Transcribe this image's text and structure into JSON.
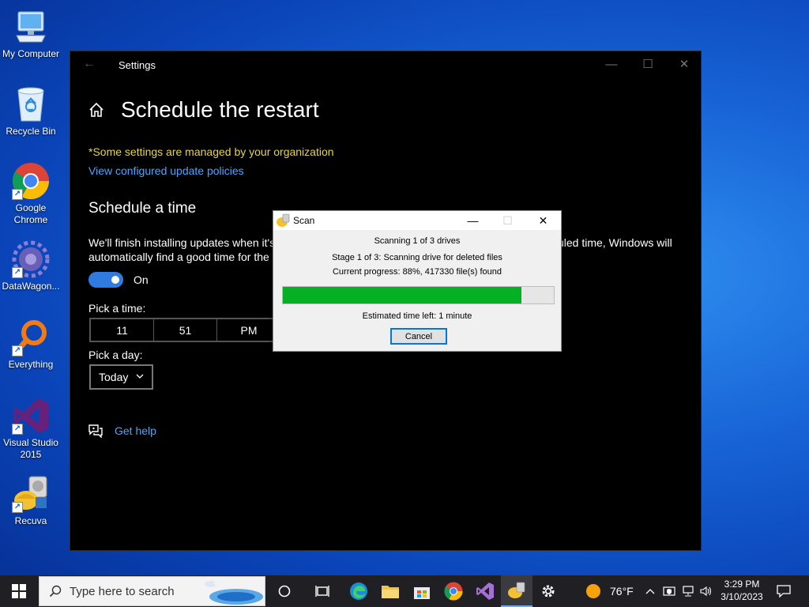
{
  "desktop": {
    "icons": [
      {
        "label": "My Computer",
        "icon": "computer-icon"
      },
      {
        "label": "Recycle Bin",
        "icon": "recycle-bin-icon"
      },
      {
        "label": "Google Chrome",
        "icon": "chrome-icon"
      },
      {
        "label": "DataWagon...",
        "icon": "datawagon-icon"
      },
      {
        "label": "Everything",
        "icon": "everything-search-icon"
      },
      {
        "label": "Visual Studio 2015",
        "icon": "visual-studio-icon"
      },
      {
        "label": "Recuva",
        "icon": "recuva-icon"
      }
    ]
  },
  "settings": {
    "window_title": "Settings",
    "page_title": "Schedule the restart",
    "org_note": "*Some settings are managed by your organization",
    "policy_link": "View configured update policies",
    "section_title": "Schedule a time",
    "description_left_1": "We'll finish installing updates when it's",
    "description_left_2": "automatically find a good time for the",
    "description_right": "uled time, Windows will",
    "toggle_label": "On",
    "toggle_state": "on",
    "pick_time_label": "Pick a time:",
    "time": {
      "hour": "11",
      "minute": "51",
      "period": "PM"
    },
    "pick_day_label": "Pick a day:",
    "day_value": "Today",
    "get_help": "Get help",
    "colors": {
      "accent": "#2f7be0",
      "link": "#4aa6ff",
      "warning": "#e5d44c"
    }
  },
  "scan_dialog": {
    "title": "Scan",
    "line1": "Scanning 1 of 3 drives",
    "line2": "Stage 1 of 3: Scanning drive for deleted files",
    "line3": "Current progress: 88%, 417330 file(s) found",
    "progress_percent": 88,
    "estimate": "Estimated time left: 1 minute",
    "cancel_label": "Cancel"
  },
  "taskbar": {
    "search_placeholder": "Type here to search",
    "pinned": [
      "cortana-icon",
      "task-view-icon",
      "edge-icon",
      "file-explorer-icon",
      "store-icon",
      "chrome-icon",
      "visual-studio-icon",
      "recuva-icon",
      "settings-icon"
    ],
    "weather_temp": "76°F",
    "clock_time": "3:29 PM",
    "clock_date": "3/10/2023"
  }
}
